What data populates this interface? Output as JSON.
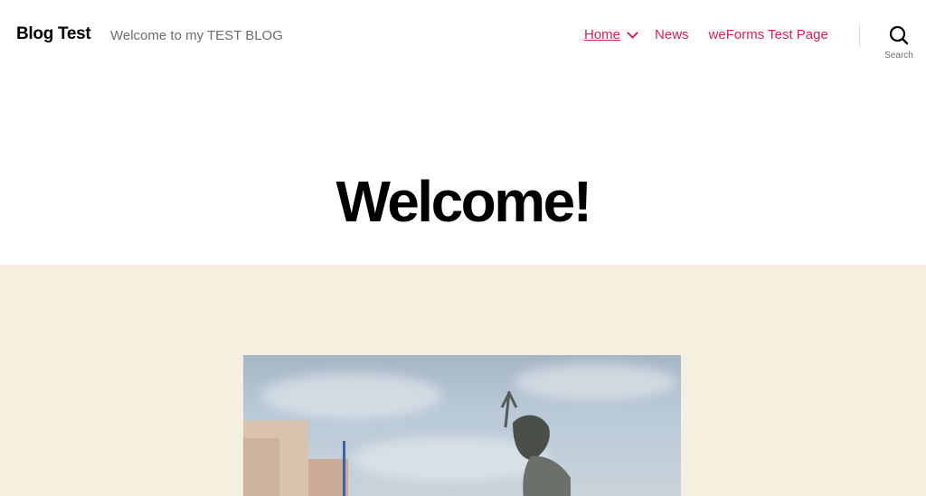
{
  "header": {
    "site_title": "Blog Test",
    "site_description": "Welcome to my TEST BLOG",
    "nav": {
      "items": [
        {
          "label": "Home",
          "active": true,
          "has_submenu": true
        },
        {
          "label": "News"
        },
        {
          "label": "weForms Test Page"
        }
      ]
    },
    "search": {
      "label": "Search",
      "icon": "search-icon"
    }
  },
  "main": {
    "page_title": "Welcome!",
    "featured_image": {
      "description": "Statue of Neptune holding a trident against a cloudy sky with buildings on the left"
    }
  },
  "colors": {
    "accent": "#cd2653",
    "featured_background": "#f5efe0",
    "secondary_text": "#6d6d6d"
  }
}
